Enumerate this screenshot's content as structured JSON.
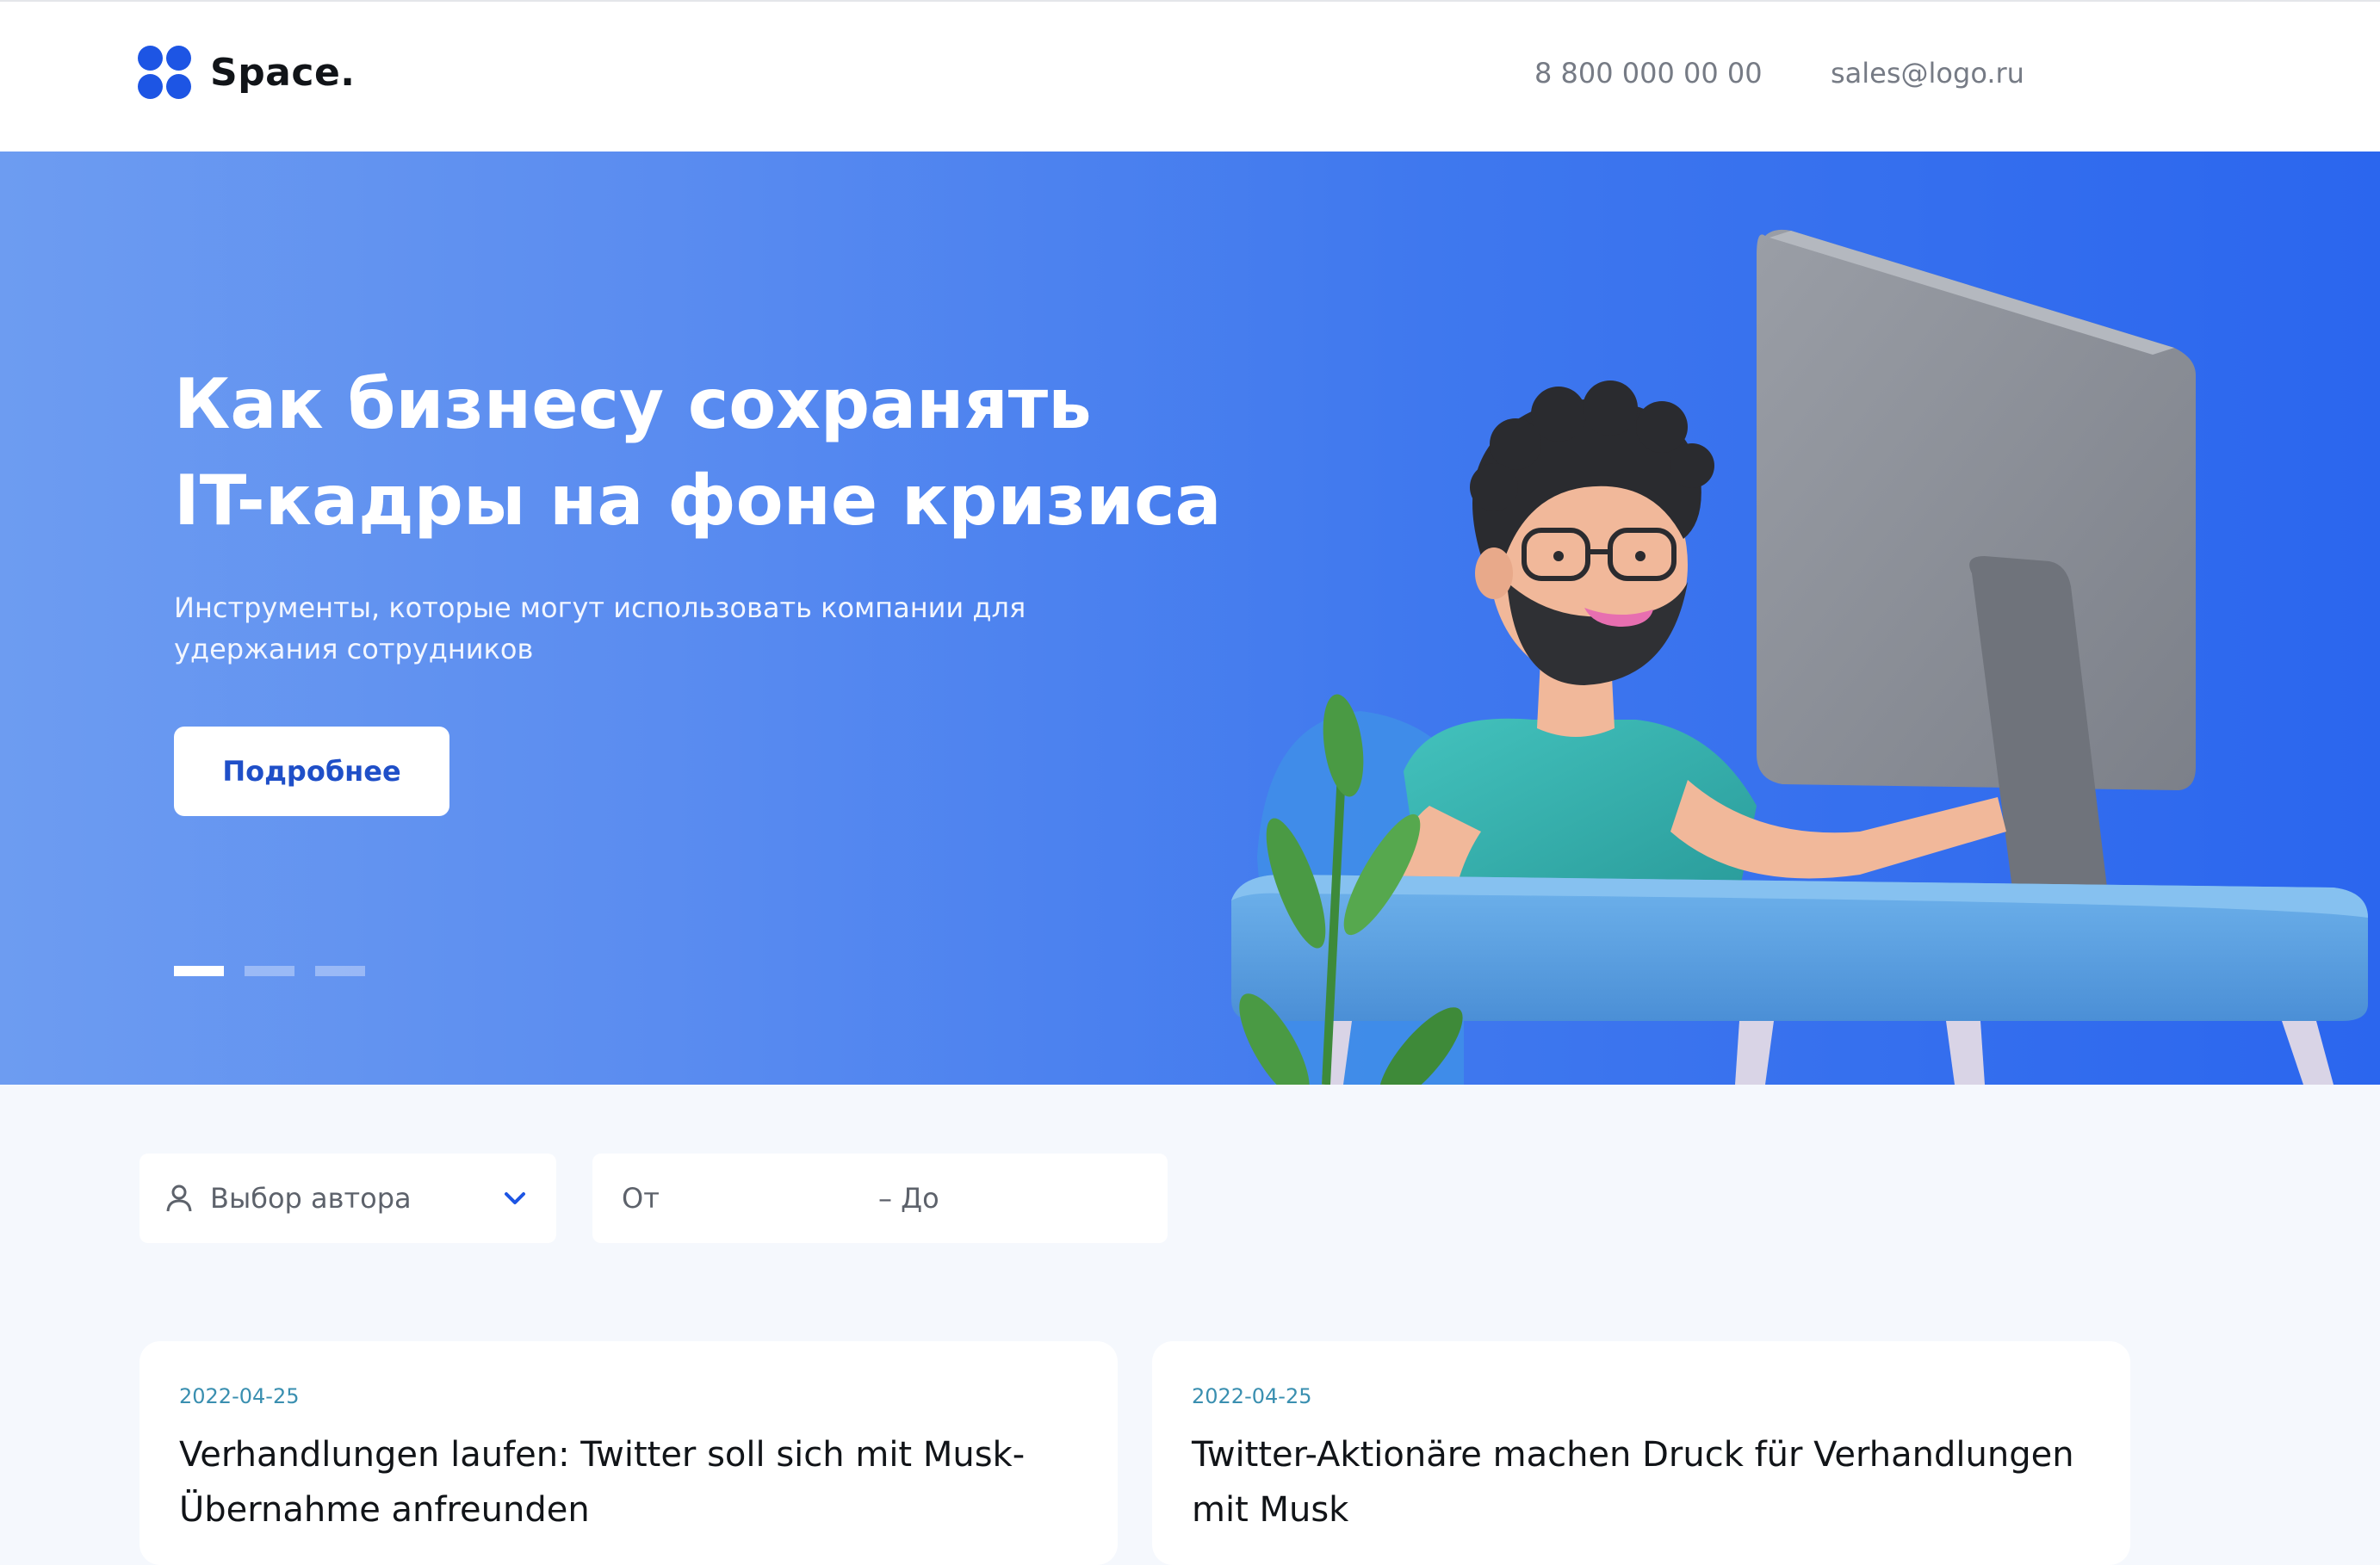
{
  "header": {
    "logo_text": "Space.",
    "phone": "8 800 000 00 00",
    "email": "sales@logo.ru"
  },
  "hero": {
    "title_line1": "Как бизнесу сохранять",
    "title_line2": "IT-кадры на фоне кризиса",
    "subtitle": "Инструменты, которые могут использовать компании для удержания сотрудников",
    "button_label": "Подробнее",
    "slides_total": 3,
    "active_slide": 1
  },
  "filters": {
    "author_label": "Выбор автора",
    "date_from_placeholder": "От",
    "date_to_placeholder": "– До"
  },
  "articles": [
    {
      "date": "2022-04-25",
      "title": "Verhandlungen laufen: Twitter soll sich mit Musk-Übernahme anfreunden"
    },
    {
      "date": "2022-04-25",
      "title": "Twitter-Aktionäre machen Druck für Verhandlungen mit Musk"
    }
  ],
  "colors": {
    "brand": "#1d55e4",
    "hero_gradient_start": "#6d9cf1",
    "hero_gradient_end": "#2b66ee",
    "date_accent": "#3a8fb0",
    "page_background": "#f5f8fd"
  },
  "icons": {
    "logo": "four-dots-logo-icon",
    "author": "user-icon",
    "dropdown": "chevron-down-icon"
  }
}
